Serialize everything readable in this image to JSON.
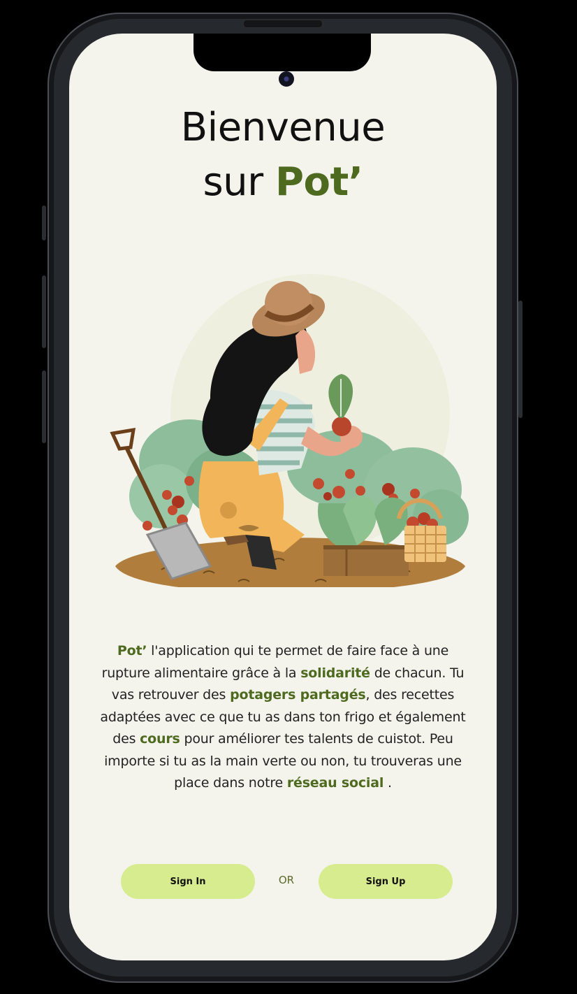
{
  "welcome": {
    "line1": "Bienvenue",
    "line2_prefix": "sur ",
    "brand": "Pot’"
  },
  "description": {
    "parts": [
      {
        "text": "Pot’",
        "bold": true
      },
      {
        "text": " l'application qui te permet de faire face à une rupture alimentaire grâce à la ",
        "bold": false
      },
      {
        "text": "solidarité",
        "bold": true
      },
      {
        "text": " de chacun. Tu vas retrouver des ",
        "bold": false
      },
      {
        "text": "potagers partagés",
        "bold": true
      },
      {
        "text": ", des recettes adaptées avec ce que tu as dans ton frigo et également des ",
        "bold": false
      },
      {
        "text": "cours",
        "bold": true
      },
      {
        "text": " pour améliorer tes talents de cuistot. Peu importe si tu as la main verte ou non, tu trouveras une place dans notre ",
        "bold": false
      },
      {
        "text": "réseau social",
        "bold": true
      },
      {
        "text": " .",
        "bold": false
      }
    ]
  },
  "actions": {
    "sign_in": "Sign In",
    "or": "OR",
    "sign_up": "Sign Up"
  },
  "colors": {
    "brand_green": "#4e6a1e",
    "button_bg": "#d6ec8e",
    "screen_bg": "#f4f4ed"
  },
  "illustration": "woman-gardening-illustration"
}
